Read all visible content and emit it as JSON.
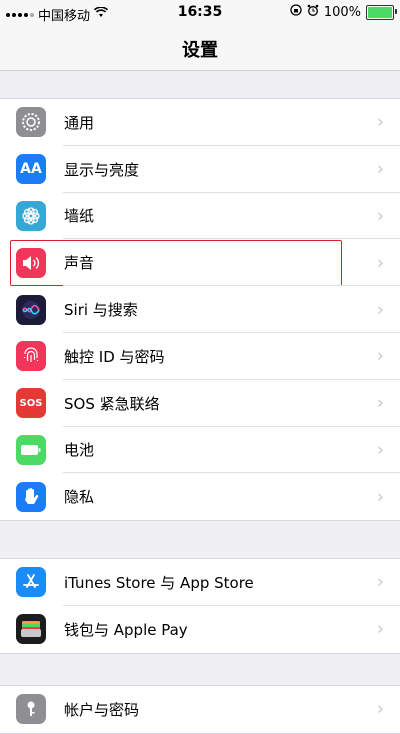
{
  "status_bar": {
    "carrier": "中国移动",
    "time": "16:35",
    "battery_percent": "100%"
  },
  "nav": {
    "title": "设置"
  },
  "groups": [
    {
      "items": [
        {
          "label": "通用",
          "icon": "gear-icon",
          "color": "#8e8e93"
        },
        {
          "label": "显示与亮度",
          "icon": "display-brightness-icon",
          "color": "#1a7cf7"
        },
        {
          "label": "墙纸",
          "icon": "wallpaper-flower-icon",
          "color": "#36a8d8"
        },
        {
          "label": "声音",
          "icon": "speaker-icon",
          "color": "#f2365a",
          "highlighted": true
        },
        {
          "label": "Siri 与搜索",
          "icon": "siri-icon",
          "color": "#1c1c3a"
        },
        {
          "label": "触控 ID 与密码",
          "icon": "fingerprint-icon",
          "color": "#f2365a"
        },
        {
          "label": "SOS 紧急联络",
          "icon": "sos-icon",
          "color": "#e53935",
          "icon_text": "SOS"
        },
        {
          "label": "电池",
          "icon": "battery-icon",
          "color": "#4cd964"
        },
        {
          "label": "隐私",
          "icon": "hand-icon",
          "color": "#1a7cf7"
        }
      ]
    },
    {
      "items": [
        {
          "label": "iTunes Store 与 App Store",
          "icon": "app-store-icon",
          "color": "#1a8cf7"
        },
        {
          "label": "钱包与 Apple Pay",
          "icon": "wallet-icon",
          "color": "#1c1c1c"
        }
      ]
    },
    {
      "items": [
        {
          "label": "帐户与密码",
          "icon": "key-icon",
          "color": "#8e8e93"
        }
      ]
    }
  ]
}
